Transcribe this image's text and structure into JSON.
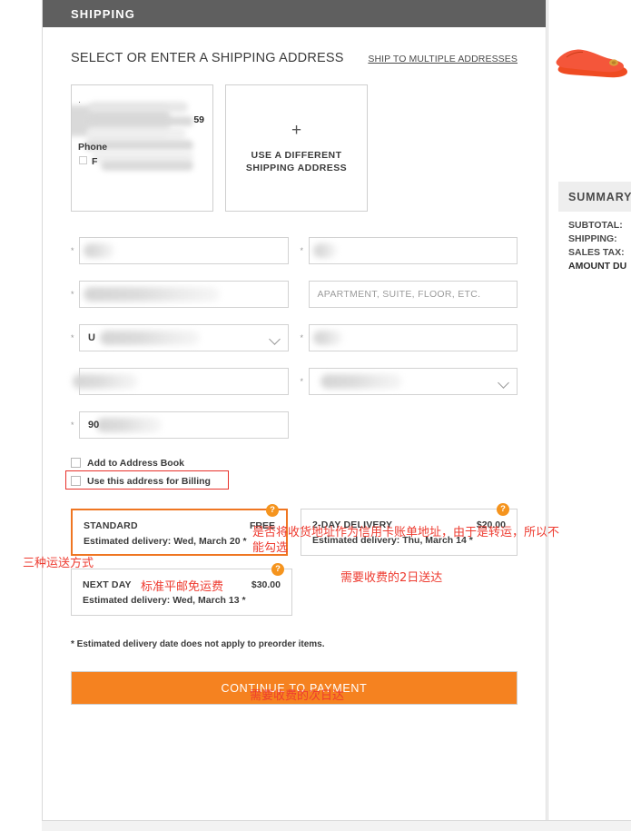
{
  "section": {
    "header_title": "SHIPPING",
    "subhead": "SELECT OR ENTER A SHIPPING ADDRESS",
    "ship_multiple_link": "SHIP TO MULTIPLE ADDRESSES"
  },
  "address_cards": {
    "saved": {
      "redacted": true,
      "visible_suffix": "59",
      "phone_label": "Phone",
      "checkbox_label_partial": "F"
    },
    "new": {
      "plus_icon": "plus-icon",
      "label_line1": "USE A DIFFERENT",
      "label_line2": "SHIPPING ADDRESS"
    }
  },
  "form": {
    "fields": [
      {
        "name": "first-name",
        "required": true,
        "value": "",
        "placeholder": "",
        "redacted": true,
        "redact_width": 34,
        "type": "text"
      },
      {
        "name": "last-name",
        "required": true,
        "value": "",
        "placeholder": "",
        "redacted": true,
        "redact_width": 26,
        "type": "text"
      },
      {
        "name": "address-1",
        "required": true,
        "value": "",
        "placeholder": "",
        "redacted": true,
        "redact_width": 150,
        "type": "text"
      },
      {
        "name": "address-2",
        "required": false,
        "value": "",
        "placeholder": "APARTMENT, SUITE, FLOOR, ETC.",
        "redacted": false,
        "redact_width": 0,
        "type": "text"
      },
      {
        "name": "country",
        "required": true,
        "value": "",
        "placeholder": "",
        "redacted": true,
        "redact_width": 110,
        "type": "select"
      },
      {
        "name": "city",
        "required": true,
        "value": "",
        "placeholder": "",
        "redacted": true,
        "redact_width": 32,
        "type": "text"
      },
      {
        "name": "company",
        "required": false,
        "value": "",
        "placeholder": "",
        "redacted": true,
        "redact_width": 62,
        "type": "text"
      },
      {
        "name": "state",
        "required": true,
        "value": "",
        "placeholder": "",
        "redacted": true,
        "redact_width": 90,
        "type": "select"
      },
      {
        "name": "postal-code",
        "required": true,
        "value": "90",
        "placeholder": "",
        "redacted": true,
        "redact_width": 72,
        "type": "text"
      }
    ]
  },
  "checkboxes": {
    "add_to_address_book": {
      "label": "Add to Address Book",
      "checked": false
    },
    "use_for_billing": {
      "label": "Use this address for Billing",
      "checked": false
    }
  },
  "shipping_options": [
    {
      "name": "STANDARD",
      "price": "FREE",
      "eta": "Estimated delivery: Wed, March 20 *",
      "selected": true,
      "help_icon": "question-mark-icon",
      "help_glyph": "?"
    },
    {
      "name": "2-DAY DELIVERY",
      "price": "$20.00",
      "eta": "Estimated delivery: Thu, March 14 *",
      "selected": false,
      "help_icon": "question-mark-icon",
      "help_glyph": "?"
    },
    {
      "name": "NEXT DAY",
      "price": "$30.00",
      "eta": "Estimated delivery: Wed, March 13 *",
      "selected": false,
      "help_icon": "question-mark-icon",
      "help_glyph": "?"
    }
  ],
  "footnote": "* Estimated delivery date does not apply to preorder items.",
  "cta": {
    "label": "CONTINUE TO PAYMENT"
  },
  "summary": {
    "title": "SUMMARY",
    "rows": [
      {
        "label": "SUBTOTAL:"
      },
      {
        "label": "SHIPPING:"
      },
      {
        "label": "SALES TAX:"
      },
      {
        "label": "AMOUNT DU"
      }
    ]
  },
  "product": {
    "alt": "orange ballet flat shoes"
  },
  "annotations": {
    "billing": "是否将收货地址作为信用卡账单地址，由于是转运，所以不\n能勾选",
    "three_methods": "三种运送方式",
    "standard": "标准平邮免运费",
    "two_day": "需要收费的2日送达",
    "next_day": "需要收费的次日达"
  },
  "colors": {
    "header_gray": "#5f5f5f",
    "accent_orange": "#f58220",
    "selected_border": "#ef7622",
    "annotation_red": "#ee3b30",
    "badge_orange": "#f5941e"
  }
}
